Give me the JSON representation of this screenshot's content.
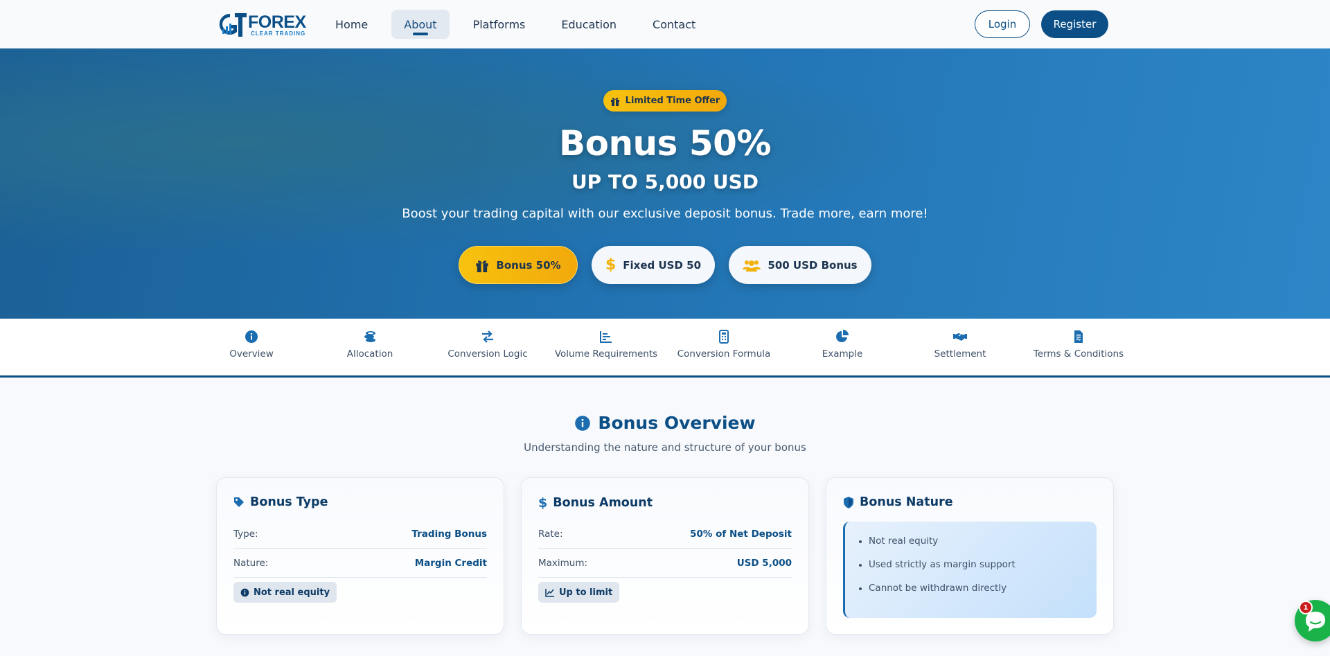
{
  "header": {
    "logo": {
      "word": "FOREX",
      "sub": "CLEAR TRADING",
      "mark": "GT"
    },
    "nav": [
      {
        "label": "Home"
      },
      {
        "label": "About",
        "active": true
      },
      {
        "label": "Platforms"
      },
      {
        "label": "Education"
      },
      {
        "label": "Contact"
      }
    ],
    "login_label": "Login",
    "register_label": "Register"
  },
  "hero": {
    "badge": "Limited Time Offer",
    "title": "Bonus 50%",
    "subtitle": "UP TO 5,000 USD",
    "description": "Boost your trading capital with our exclusive deposit bonus. Trade more, earn more!",
    "pills": [
      {
        "label": "Bonus 50%",
        "icon": "gift-icon"
      },
      {
        "label": "Fixed USD 50",
        "icon": "dollar-icon"
      },
      {
        "label": "500 USD Bonus",
        "icon": "users-icon"
      }
    ]
  },
  "tabs": [
    {
      "label": "Overview",
      "icon": "info-circle-icon"
    },
    {
      "label": "Allocation",
      "icon": "coins-icon"
    },
    {
      "label": "Conversion Logic",
      "icon": "exchange-icon"
    },
    {
      "label": "Volume Requirements",
      "icon": "bar-chart-icon"
    },
    {
      "label": "Conversion Formula",
      "icon": "calculator-icon"
    },
    {
      "label": "Example",
      "icon": "pie-chart-icon"
    },
    {
      "label": "Settlement",
      "icon": "handshake-icon"
    },
    {
      "label": "Terms & Conditions",
      "icon": "file-contract-icon"
    }
  ],
  "overview": {
    "title": "Bonus Overview",
    "subtitle": "Understanding the nature and structure of your bonus",
    "cards": {
      "type": {
        "title": "Bonus Type",
        "rows": [
          {
            "key": "Type:",
            "value": "Trading Bonus"
          },
          {
            "key": "Nature:",
            "value": "Margin Credit"
          }
        ],
        "chip": "Not real equity"
      },
      "amount": {
        "title": "Bonus Amount",
        "rows": [
          {
            "key": "Rate:",
            "value": "50% of Net Deposit"
          },
          {
            "key": "Maximum:",
            "value": "USD 5,000"
          }
        ],
        "chip": "Up to limit"
      },
      "nature": {
        "title": "Bonus Nature",
        "items": [
          "Not real equity",
          "Used strictly as margin support",
          "Cannot be withdrawn directly"
        ]
      }
    }
  },
  "chat": {
    "badge_count": "1"
  },
  "colors": {
    "brand": "#0b4f86",
    "accent": "#f7c20e",
    "chat": "#19b34a",
    "badge": "#c91d1d"
  }
}
